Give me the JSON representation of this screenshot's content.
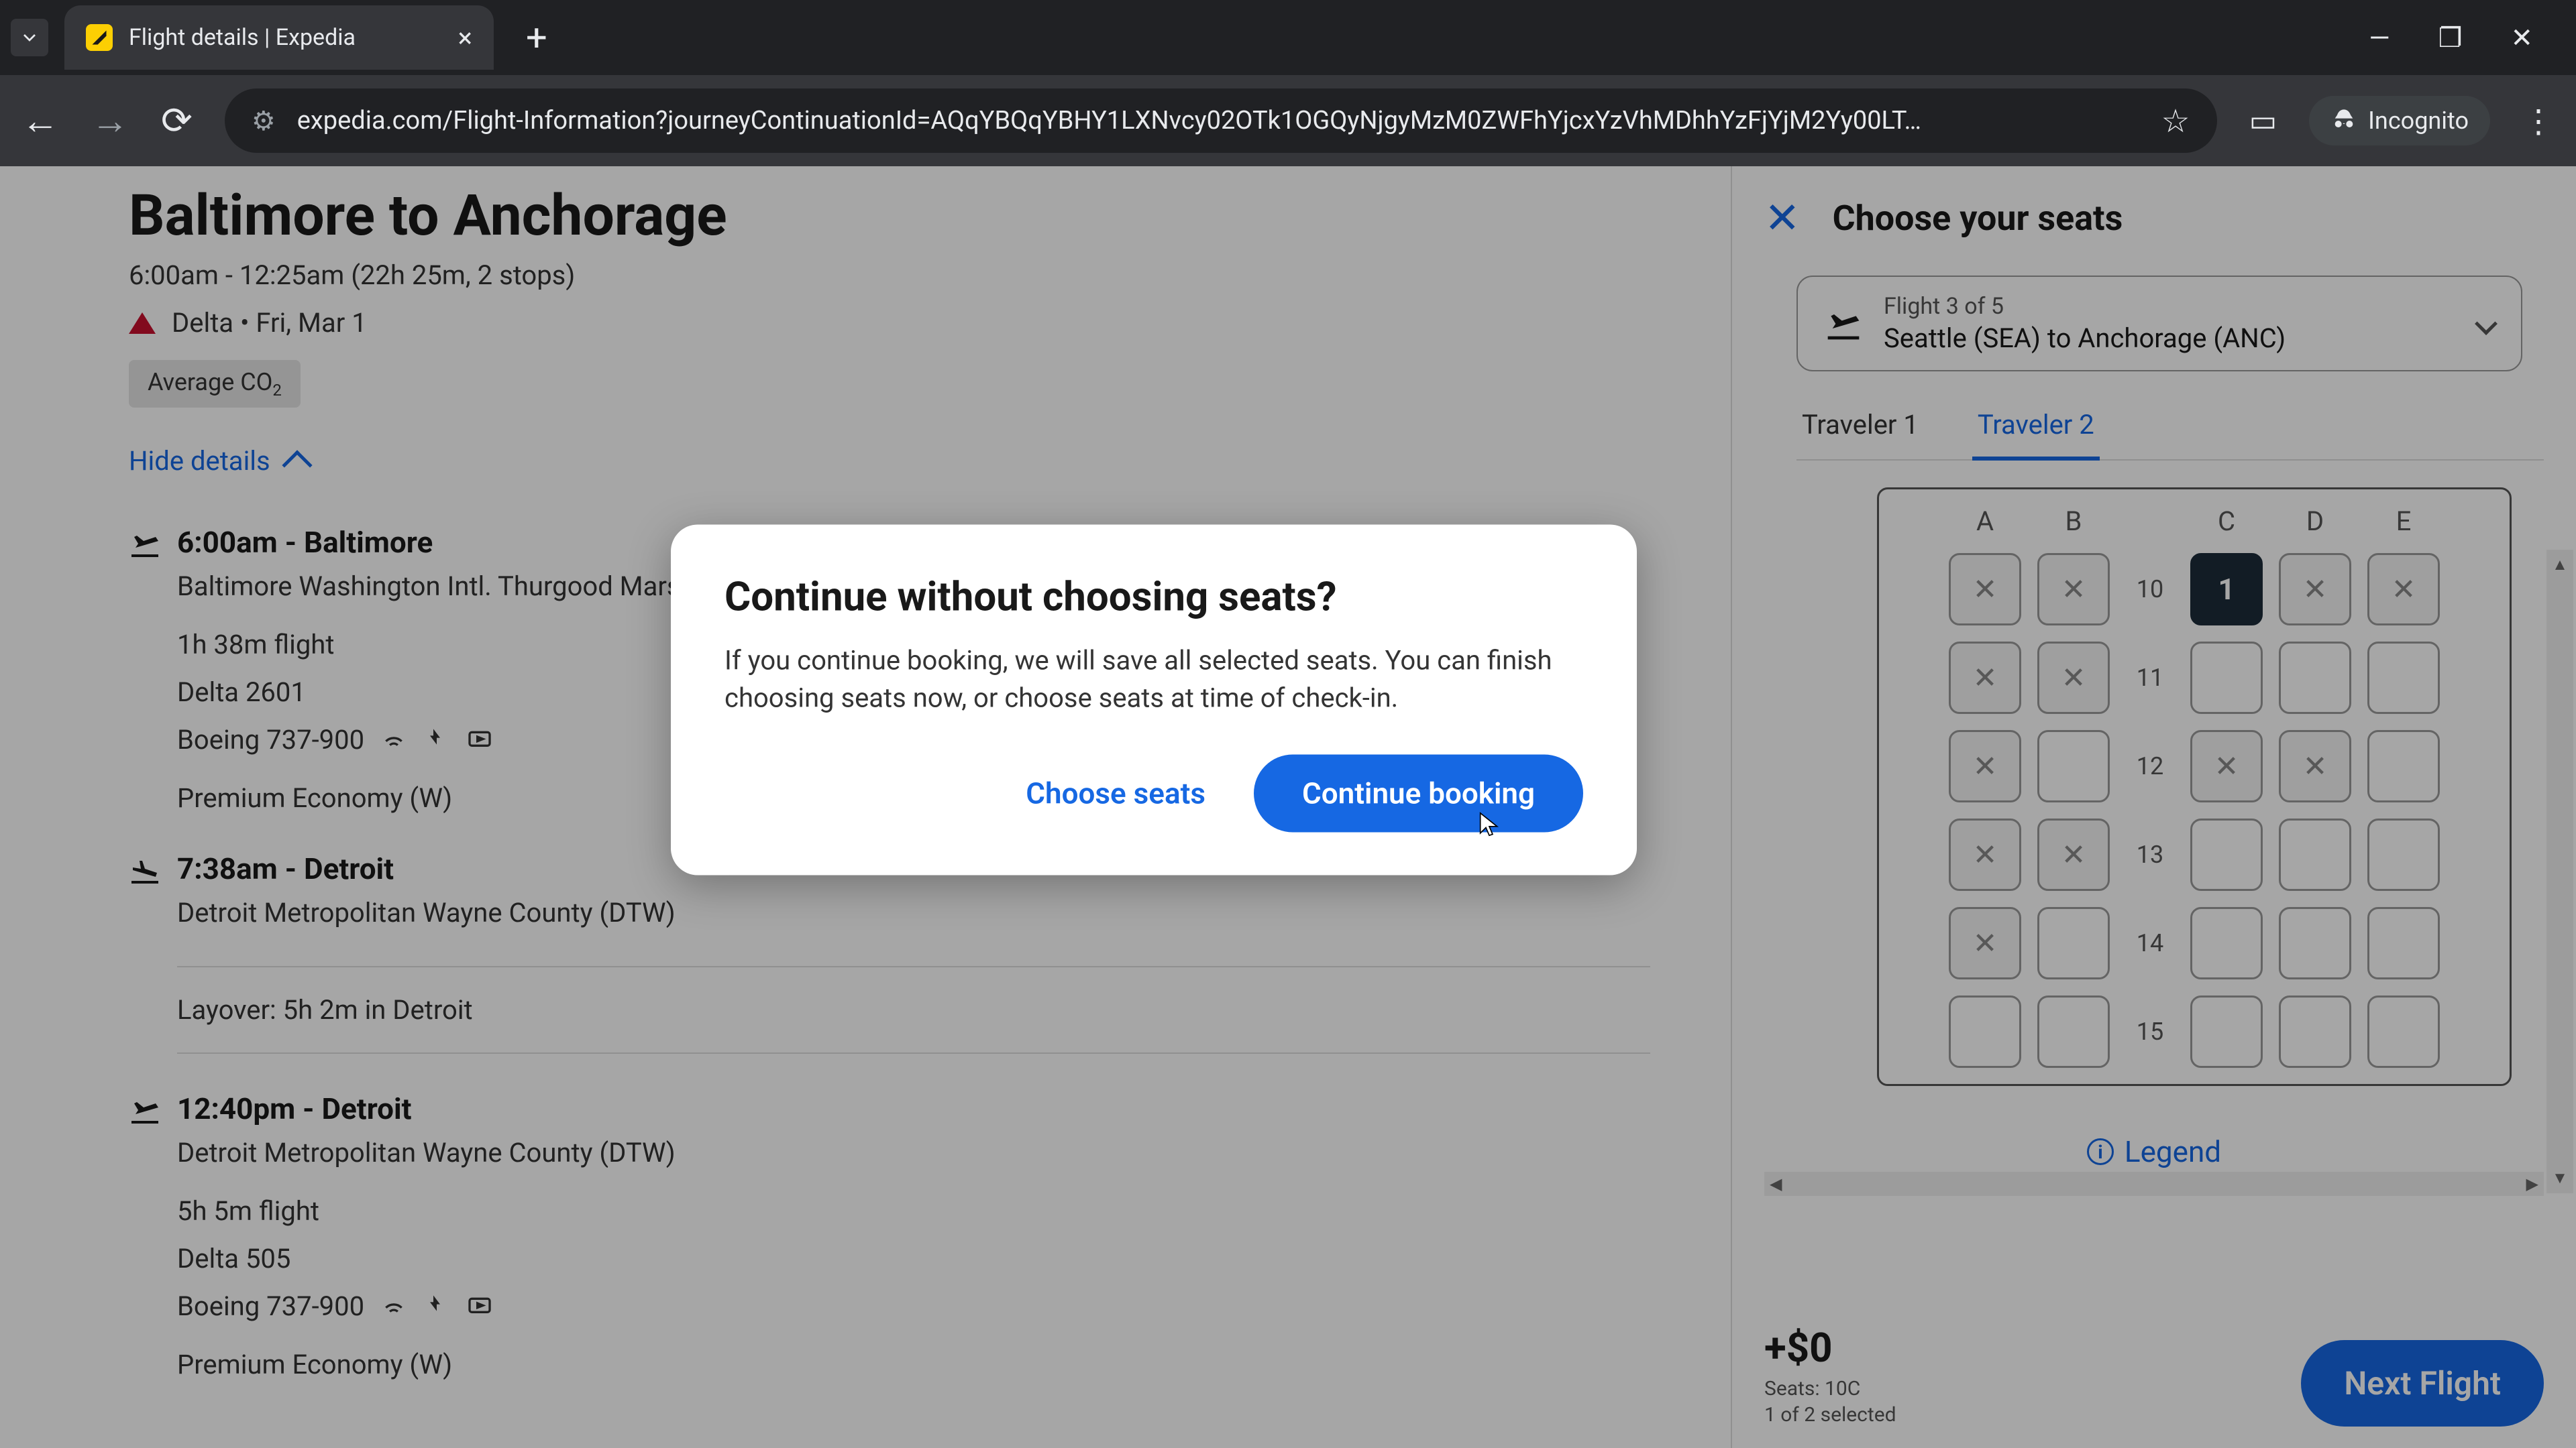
{
  "browser": {
    "tab_title": "Flight details | Expedia",
    "url": "expedia.com/Flight-Information?journeyContinuationId=AQqYBQqYBHY1LXNvcy02OTk1OGQyNjgyMzM0ZWFhYjcxYzVhMDhhYzFjYjM2Yy00LT…",
    "incognito_label": "Incognito"
  },
  "flight": {
    "title": "Baltimore to Anchorage",
    "subtitle": "6:00am - 12:25am (22h 25m, 2 stops)",
    "airline_date": "Delta • Fri, Mar 1",
    "co2_label": "Average CO",
    "co2_sub": "2",
    "hide_details": "Hide details"
  },
  "segments": [
    {
      "time": "6:00am - Baltimore",
      "airport": "Baltimore Washington Intl. Thurgood Marshall (BWI)",
      "duration": "1h 38m flight",
      "flight_number": "Delta 2601",
      "aircraft": "Boeing 737-900",
      "cabin": "Premium Economy (W)"
    },
    {
      "time": "7:38am - Detroit",
      "airport": "Detroit Metropolitan Wayne County (DTW)"
    }
  ],
  "layover": "Layover: 5h 2m in Detroit",
  "segment2": {
    "time": "12:40pm - Detroit",
    "airport": "Detroit Metropolitan Wayne County (DTW)",
    "duration": "5h 5m flight",
    "flight_number": "Delta 505",
    "aircraft": "Boeing 737-900",
    "cabin": "Premium Economy (W)"
  },
  "seat_panel": {
    "title": "Choose your seats",
    "flight_num": "Flight 3 of 5",
    "route": "Seattle (SEA) to Anchorage (ANC)",
    "travelers": [
      "Traveler 1",
      "Traveler 2"
    ],
    "active_traveler": 1,
    "columns": [
      "A",
      "B",
      "C",
      "D",
      "E"
    ],
    "selected_label": "1",
    "rows": [
      {
        "num": "10",
        "seats": [
          "occupied",
          "occupied",
          "selected",
          "occupied",
          "occupied"
        ]
      },
      {
        "num": "11",
        "seats": [
          "occupied",
          "occupied",
          "open",
          "open",
          "open"
        ]
      },
      {
        "num": "12",
        "seats": [
          "occupied",
          "open",
          "occupied",
          "occupied",
          "open"
        ]
      },
      {
        "num": "13",
        "seats": [
          "occupied",
          "occupied",
          "open",
          "open",
          "open"
        ]
      },
      {
        "num": "14",
        "seats": [
          "occupied",
          "open",
          "open",
          "open",
          "open"
        ]
      },
      {
        "num": "15",
        "seats": [
          "open",
          "open",
          "open",
          "open",
          "open"
        ]
      }
    ],
    "legend": "Legend",
    "price": "+$0",
    "seats_summary": "Seats: 10C",
    "selected_count": "1 of 2 selected",
    "next_button": "Next Flight"
  },
  "modal": {
    "title": "Continue without choosing seats?",
    "body": "If you continue booking, we will save all selected seats. You can finish choosing seats now, or choose seats at time of check-in.",
    "secondary": "Choose seats",
    "primary": "Continue booking"
  }
}
